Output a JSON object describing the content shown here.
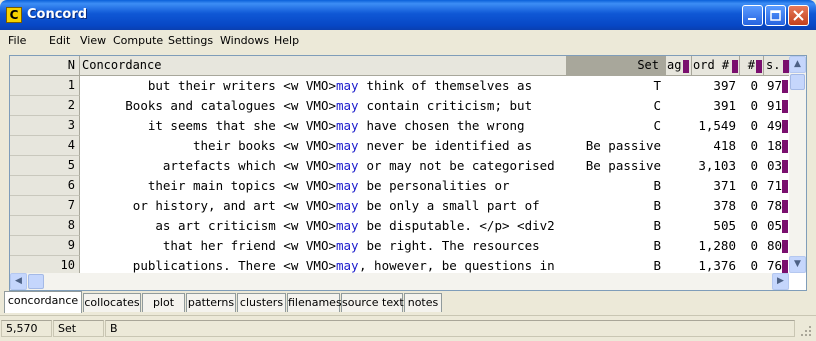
{
  "window": {
    "title": "Concord",
    "icon_letter": "C"
  },
  "menu": [
    "File",
    "Edit",
    "View",
    "Compute",
    "Settings",
    "Windows",
    "Help"
  ],
  "columns": {
    "n": "N",
    "concordance": "Concordance",
    "set": "Set",
    "tag": "ag",
    "word": "ord #",
    "num": "#",
    "s": "s."
  },
  "rows": [
    {
      "n": "1",
      "left": "but their writers <w VMO>",
      "kw": "may",
      "right": " think of themselves as",
      "set": "T",
      "word": "397",
      "num": "0",
      "s": "97"
    },
    {
      "n": "2",
      "left": "Books and catalogues <w VMO>",
      "kw": "may",
      "right": " contain criticism; but",
      "set": "C",
      "word": "391",
      "num": "0",
      "s": "91"
    },
    {
      "n": "3",
      "left": "it seems that she <w VMO>",
      "kw": "may",
      "right": " have chosen the wrong",
      "set": "C",
      "word": "1,549",
      "num": "0",
      "s": "49"
    },
    {
      "n": "4",
      "left": "their books <w VMO>",
      "kw": "may",
      "right": " never be identified as",
      "set": "Be passive",
      "word": "418",
      "num": "0",
      "s": "18"
    },
    {
      "n": "5",
      "left": "artefacts which <w VMO>",
      "kw": "may",
      "right": " or may not be categorised",
      "set": "Be passive",
      "word": "3,103",
      "num": "0",
      "s": "03"
    },
    {
      "n": "6",
      "left": "their main topics <w VMO>",
      "kw": "may",
      "right": " be personalities or",
      "set": "B",
      "word": "371",
      "num": "0",
      "s": "71"
    },
    {
      "n": "7",
      "left": "or history, and art <w VMO>",
      "kw": "may",
      "right": " be only a small part of",
      "set": "B",
      "word": "378",
      "num": "0",
      "s": "78"
    },
    {
      "n": "8",
      "left": "as art criticism <w VMO>",
      "kw": "may",
      "right": " be disputable. </p> <div2",
      "set": "B",
      "word": "505",
      "num": "0",
      "s": "05"
    },
    {
      "n": "9",
      "left": "that her friend <w VMO>",
      "kw": "may",
      "right": " be right. The resources",
      "set": "B",
      "word": "1,280",
      "num": "0",
      "s": "80"
    },
    {
      "n": "10",
      "left": "publications. There <w VMO>",
      "kw": "may",
      "right": ", however, be questions in",
      "set": "B",
      "word": "1,376",
      "num": "0",
      "s": "76"
    }
  ],
  "tabs": [
    "concordance",
    "collocates",
    "plot",
    "patterns",
    "clusters",
    "filenames",
    "source text",
    "notes"
  ],
  "active_tab": "concordance",
  "status": {
    "count": "5,570",
    "column": "Set",
    "value": "B"
  },
  "colors": {
    "title_bar": "#0a5fd9",
    "keyword": "#1a1acc",
    "marker": "#7a0f6e",
    "selected_header": "#a8a79b"
  }
}
